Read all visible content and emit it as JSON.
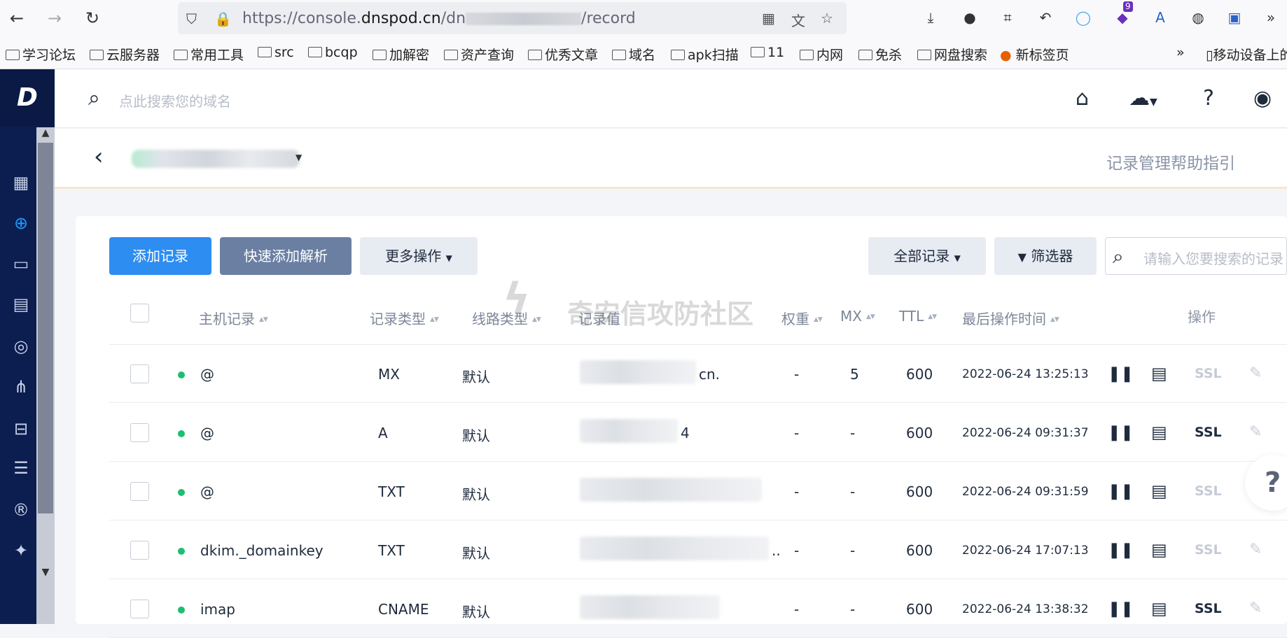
{
  "browser": {
    "url_prefix": "https://console.",
    "url_domain": "dnspod.cn",
    "url_mid": "/dn",
    "url_suffix": "/record",
    "ext_badge": "9"
  },
  "bookmarks": [
    "学习论坛",
    "云服务器",
    "常用工具",
    "src",
    "bcqp",
    "加解密",
    "资产查询",
    "优秀文章",
    "域名",
    "apk扫描",
    "11",
    "内网",
    "免杀",
    "网盘搜索",
    "新标签页",
    "移动设备上的"
  ],
  "app": {
    "logo": "D",
    "search_placeholder": "点此搜索您的域名",
    "help_link": "记录管理帮助指引"
  },
  "toolbar": {
    "add_record": "添加记录",
    "quick_add": "快速添加解析",
    "more_ops": "更多操作",
    "all_records": "全部记录",
    "filter": "筛选器",
    "search_placeholder": "请输入您要搜索的记录"
  },
  "columns": {
    "host": "主机记录",
    "type": "记录类型",
    "line": "线路类型",
    "value": "记录值",
    "weight": "权重",
    "mx": "MX",
    "ttl": "TTL",
    "time": "最后操作时间",
    "ops": "操作"
  },
  "watermark": "奇安信攻防社区",
  "rows": [
    {
      "host": "@",
      "type": "MX",
      "line": "默认",
      "value_tail": "cn.",
      "weight": "-",
      "mx": "5",
      "ttl": "600",
      "time": "2022-06-24 13:25:13",
      "ssl": "SSL",
      "ssl_active": false
    },
    {
      "host": "@",
      "type": "A",
      "line": "默认",
      "value_tail": "4",
      "weight": "-",
      "mx": "-",
      "ttl": "600",
      "time": "2022-06-24 09:31:37",
      "ssl": "SSL",
      "ssl_active": true
    },
    {
      "host": "@",
      "type": "TXT",
      "line": "默认",
      "value_tail": "",
      "weight": "-",
      "mx": "-",
      "ttl": "600",
      "time": "2022-06-24 09:31:59",
      "ssl": "SSL",
      "ssl_active": false
    },
    {
      "host": "dkim._domainkey",
      "type": "TXT",
      "line": "默认",
      "value_tail": "..",
      "weight": "-",
      "mx": "-",
      "ttl": "600",
      "time": "2022-06-24 17:07:13",
      "ssl": "SSL",
      "ssl_active": false
    },
    {
      "host": "imap",
      "type": "CNAME",
      "line": "默认",
      "value_tail": "",
      "weight": "-",
      "mx": "-",
      "ttl": "600",
      "time": "2022-06-24 13:38:32",
      "ssl": "SSL",
      "ssl_active": true
    }
  ],
  "colors": {
    "accent": "#2d8df0",
    "sidebar": "#0c1e4f",
    "status_enabled": "#1bbf72",
    "ssl_inactive": "#c5cbd6",
    "ssl_active": "#1f2b3d"
  }
}
